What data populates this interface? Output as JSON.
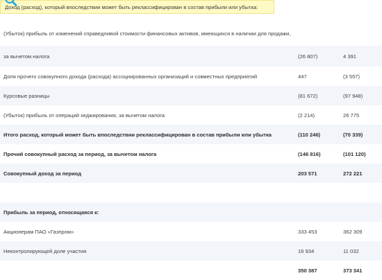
{
  "header_title": "Доход (расход), который впоследствии может быть реклассифицирован в состав прибыли или убытка:",
  "rows": [
    {
      "label": "(Убыток) прибыль от изменений справедливой стоимости финансовых активов, имеющихся в наличии для продажи,",
      "v1": "",
      "v2": ""
    },
    {
      "label": "за вычетом налога",
      "v1": "(26 807)",
      "v2": "4 391"
    },
    {
      "label": "Доля прочего совокупного дохода (расхода) ассоциированных организаций и совместных предприятий",
      "v1": "447",
      "v2": "(3 557)"
    },
    {
      "label": "Курсовые разницы",
      "v1": "(81 672)",
      "v2": "(97 948)"
    },
    {
      "label": "(Убыток) прибыль от операций хеджирования, за вычетом налога",
      "v1": "(2 214)",
      "v2": "26 775"
    },
    {
      "label": "Итого расход, который может быть впоследствии реклассифицирован в состав прибыли или убытка",
      "v1": "(110 246)",
      "v2": "(70 339)"
    },
    {
      "label": "Прочий совокупный расход за период, за вычетом налога",
      "v1": "(146 816)",
      "v2": "(101 120)"
    },
    {
      "label": "Совокупный доход за период",
      "v1": "203 571",
      "v2": "272 221"
    },
    {
      "label": "",
      "v1": "",
      "v2": ""
    },
    {
      "label": "Прибыль за период, относящаяся к:",
      "v1": "",
      "v2": ""
    },
    {
      "label": "Акционерам ПАО «Газпром»",
      "v1": "333 453",
      "v2": "362 309"
    },
    {
      "label": "Неконтролирующей доле участия",
      "v1": "16 934",
      "v2": "11 032"
    },
    {
      "label": "",
      "v1": "350 387",
      "v2": "373 341"
    }
  ]
}
